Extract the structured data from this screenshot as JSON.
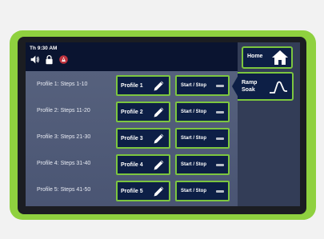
{
  "header": {
    "clock": "Th 9:30 AM",
    "status_icons": [
      "speaker-icon",
      "lock-icon",
      "alarm-icon"
    ]
  },
  "profiles": [
    {
      "label": "Profile 1: Steps 1-10",
      "button": "Profile 1",
      "start_stop": "Start / Stop"
    },
    {
      "label": "Profile 2: Steps 11-20",
      "button": "Profile 2",
      "start_stop": "Start / Stop"
    },
    {
      "label": "Profile 3: Steps 21-30",
      "button": "Profile 3",
      "start_stop": "Start / Stop"
    },
    {
      "label": "Profile 4: Steps 31-40",
      "button": "Profile 4",
      "start_stop": "Start / Stop"
    },
    {
      "label": "Profile 5: Steps 41-50",
      "button": "Profile 5",
      "start_stop": "Start / Stop"
    }
  ],
  "sidebar": {
    "home_label": "Home",
    "ramp_label_line1": "Ramp",
    "ramp_label_line2": "Soak"
  },
  "colors": {
    "bezel": "#8fd13f",
    "button_border": "#7cc63f",
    "button_fill": "#0d1f46",
    "content_bg": "#56617d"
  }
}
